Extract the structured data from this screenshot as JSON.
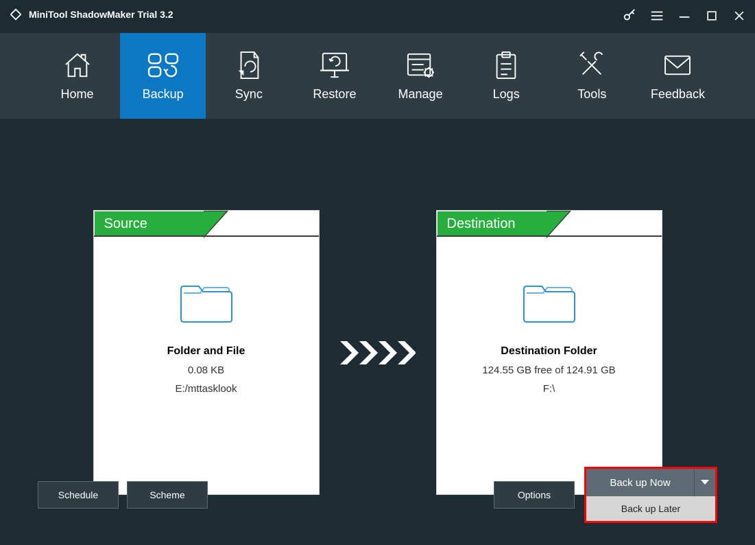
{
  "app": {
    "title": "MiniTool ShadowMaker Trial 3.2"
  },
  "nav": {
    "home": "Home",
    "backup": "Backup",
    "sync": "Sync",
    "restore": "Restore",
    "manage": "Manage",
    "logs": "Logs",
    "tools": "Tools",
    "feedback": "Feedback"
  },
  "source": {
    "tab": "Source",
    "title": "Folder and File",
    "size": "0.08 KB",
    "path": "E:/mttasklook"
  },
  "destination": {
    "tab": "Destination",
    "title": "Destination Folder",
    "free": "124.55 GB free of 124.91 GB",
    "path": "F:\\"
  },
  "buttons": {
    "schedule": "Schedule",
    "scheme": "Scheme",
    "options": "Options",
    "backup_now": "Back up Now",
    "backup_later": "Back up Later"
  }
}
